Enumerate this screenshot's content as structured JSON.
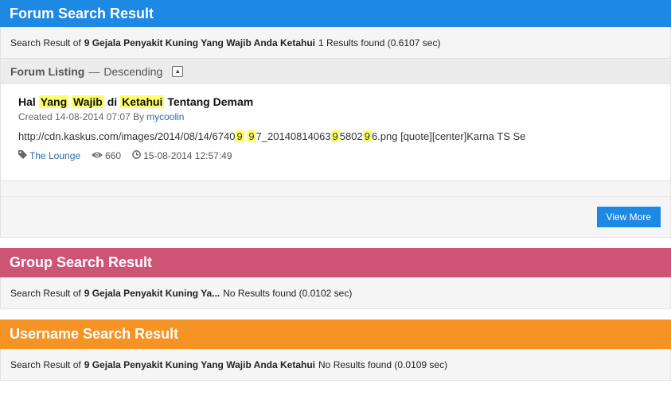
{
  "forum": {
    "heading": "Forum Search Result",
    "summary": {
      "prefix": "Search Result of",
      "query": "9 Gejala Penyakit Kuning Yang Wajib Anda Ketahui",
      "status": "1 Results found (0.6107 sec)"
    },
    "listing": {
      "title": "Forum Listing",
      "separator": "—",
      "order": "Descending",
      "toggle_glyph": "▲"
    },
    "result": {
      "title_parts": [
        {
          "text": "Hal ",
          "hl": false
        },
        {
          "text": "Yang",
          "hl": true
        },
        {
          "text": " ",
          "hl": false
        },
        {
          "text": "Wajib",
          "hl": true
        },
        {
          "text": " di ",
          "hl": false
        },
        {
          "text": "Ketahui",
          "hl": true
        },
        {
          "text": " Tentang Demam",
          "hl": false
        }
      ],
      "created_prefix": "Created 14-08-2014 07:07 By",
      "author": "mycoolin",
      "snippet_parts": [
        {
          "text": "http://cdn.kaskus.com/images/2014/08/14/6740",
          "hl": false
        },
        {
          "text": "9",
          "hl": true
        },
        {
          "text": " ",
          "hl": false
        },
        {
          "text": "9",
          "hl": true
        },
        {
          "text": "7_20140814063",
          "hl": false
        },
        {
          "text": "9",
          "hl": true
        },
        {
          "text": "5802",
          "hl": false
        },
        {
          "text": "9",
          "hl": true
        },
        {
          "text": "6.png [quote][center]Karna TS Se",
          "hl": false
        }
      ],
      "forum_name": "The Lounge",
      "views": "660",
      "last_post": "15-08-2014 12:57:49",
      "icons": {
        "tag": "tag-icon",
        "views": "eye-icon",
        "time": "clock-icon"
      }
    },
    "view_more_label": "View More"
  },
  "group": {
    "heading": "Group Search Result",
    "summary": {
      "prefix": "Search Result of",
      "query": "9 Gejala Penyakit Kuning Ya...",
      "status": "No Results found (0.0102 sec)"
    }
  },
  "username": {
    "heading": "Username Search Result",
    "summary": {
      "prefix": "Search Result of",
      "query": "9 Gejala Penyakit Kuning Yang Wajib Anda Ketahui",
      "status": "No Results found (0.0109 sec)"
    }
  },
  "colors": {
    "forum_accent": "#1e88e5",
    "group_accent": "#ce5473",
    "username_accent": "#f59425",
    "highlight": "#ffff66"
  }
}
